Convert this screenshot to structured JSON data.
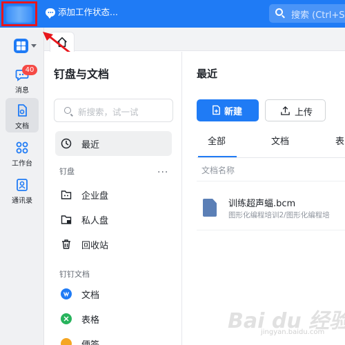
{
  "topbar": {
    "status_text": "添加工作状态...",
    "search_placeholder": "搜索 (Ctrl+S",
    "accent": "#1f7bf5"
  },
  "rail": {
    "messages": {
      "label": "消息",
      "badge": "40",
      "icon": "chat-bubble-icon"
    },
    "docs": {
      "label": "文档",
      "icon": "document-icon"
    },
    "workbench": {
      "label": "工作台",
      "icon": "apps-icon"
    },
    "contacts": {
      "label": "通讯录",
      "icon": "contacts-icon"
    }
  },
  "sidebar": {
    "title": "钉盘与文档",
    "search_placeholder": "新搜索，试一试",
    "recent": "最近",
    "section_drive": "钉盘",
    "more": "···",
    "enterprise": "企业盘",
    "private": "私人盘",
    "recycle": "回收站",
    "section_docs": "钉钉文档",
    "doc": "文档",
    "sheet": "表格",
    "note": "便签"
  },
  "main": {
    "title": "最近",
    "new_button": "新建",
    "upload_button": "上传",
    "tabs": [
      "全部",
      "文档",
      "表"
    ],
    "column_header": "文档名称",
    "files": [
      {
        "name": "训练超声蝠.bcm",
        "path": "图形化编程培训2/图形化编程培"
      }
    ]
  },
  "watermark": {
    "text": "Bai du 经验",
    "sub": "jingyan.baidu.com"
  }
}
